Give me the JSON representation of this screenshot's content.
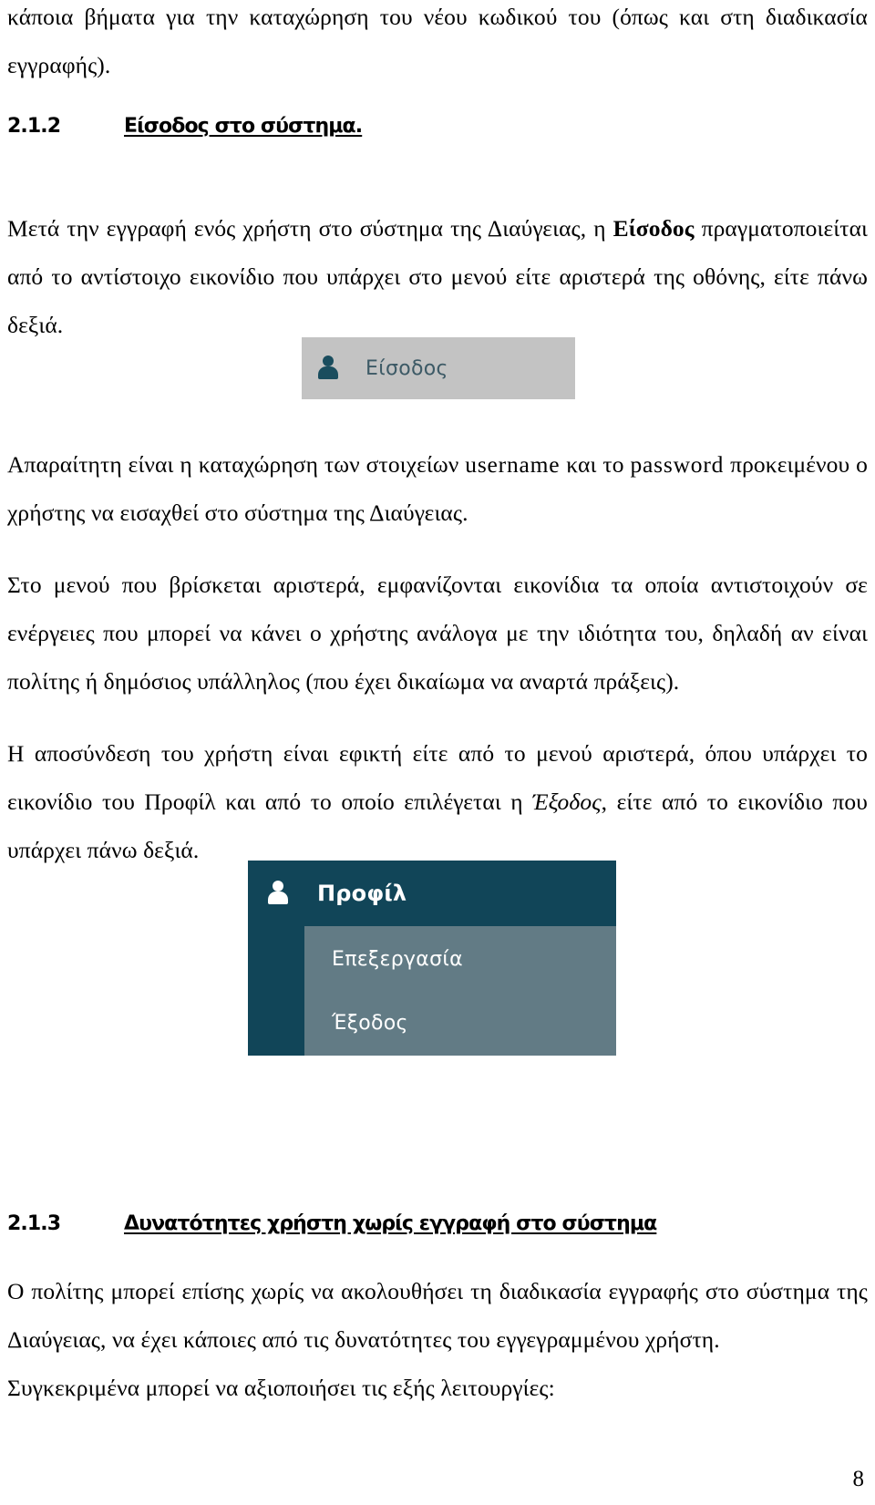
{
  "document": {
    "page_number": "8",
    "paragraphs": {
      "intro_continued": "κάποια βήματα για την καταχώρηση του νέου κωδικού του (όπως και στη διαδικασία εγγραφής).",
      "login_intro_pre_bold": "Μετά την εγγραφή ενός χρήστη στο σύστημα της Διαύγειας, η ",
      "login_intro_bold": "Είσοδος",
      "login_intro_post_bold": " πραγματοποιείται από το αντίστοιχο εικονίδιο που υπάρχει στο μενού είτε αριστερά της οθόνης, είτε πάνω δεξιά.",
      "credentials_a": "Απαραίτητη είναι η καταχώρηση των στοιχείων ",
      "credentials_username": "username",
      "credentials_b": " και το ",
      "credentials_password": "password",
      "credentials_c": " προκειμένου ο χρήστης να εισαχθεί στο σύστημα της Διαύγειας.",
      "menu_icons": "Στο μενού που βρίσκεται αριστερά, εμφανίζονται εικονίδια τα οποία αντιστοιχούν σε ενέργειες που μπορεί να κάνει ο χρήστης ανάλογα με την ιδιότητα του, δηλαδή αν είναι πολίτης ή δημόσιος υπάλληλος (που έχει δικαίωμα να αναρτά πράξεις).",
      "logout_a": "Η αποσύνδεση του χρήστη είναι εφικτή είτε από το μενού αριστερά, όπου υπάρχει το εικονίδιο του Προφίλ και από το οποίο επιλέγεται η ",
      "logout_italic": "Έξοδος",
      "logout_b": ", είτε από το εικονίδιο που υπάρχει πάνω δεξιά.",
      "guest_a": "Ο πολίτης μπορεί επίσης χωρίς να ακολουθήσει τη διαδικασία εγγραφής στο σύστημα της Διαύγειας,  να έχει κάποιες από τις δυνατότητες του εγγεγραμμένου χρήστη.",
      "guest_b": "Συγκεκριμένα μπορεί να αξιοποιήσει  τις εξής λειτουργίες:"
    },
    "headings": [
      {
        "number": "2.1.2",
        "title": "Είσοδος στο σύστημα."
      },
      {
        "number": "2.1.3",
        "title": "Δυνατότητες χρήστη χωρίς εγγραφή στο σύστημα"
      }
    ]
  },
  "screenshots": {
    "login_button": {
      "label": "Είσοδος",
      "icon": "user-icon",
      "background_color": "#c3c3c3",
      "text_color": "#3d5a66"
    },
    "profile_menu": {
      "title": "Προφίλ",
      "icon": "user-icon",
      "background_color": "#114558",
      "submenu_background_color": "#627b85",
      "items": [
        {
          "label": "Επεξεργασία"
        },
        {
          "label": "Έξοδος"
        }
      ]
    }
  }
}
